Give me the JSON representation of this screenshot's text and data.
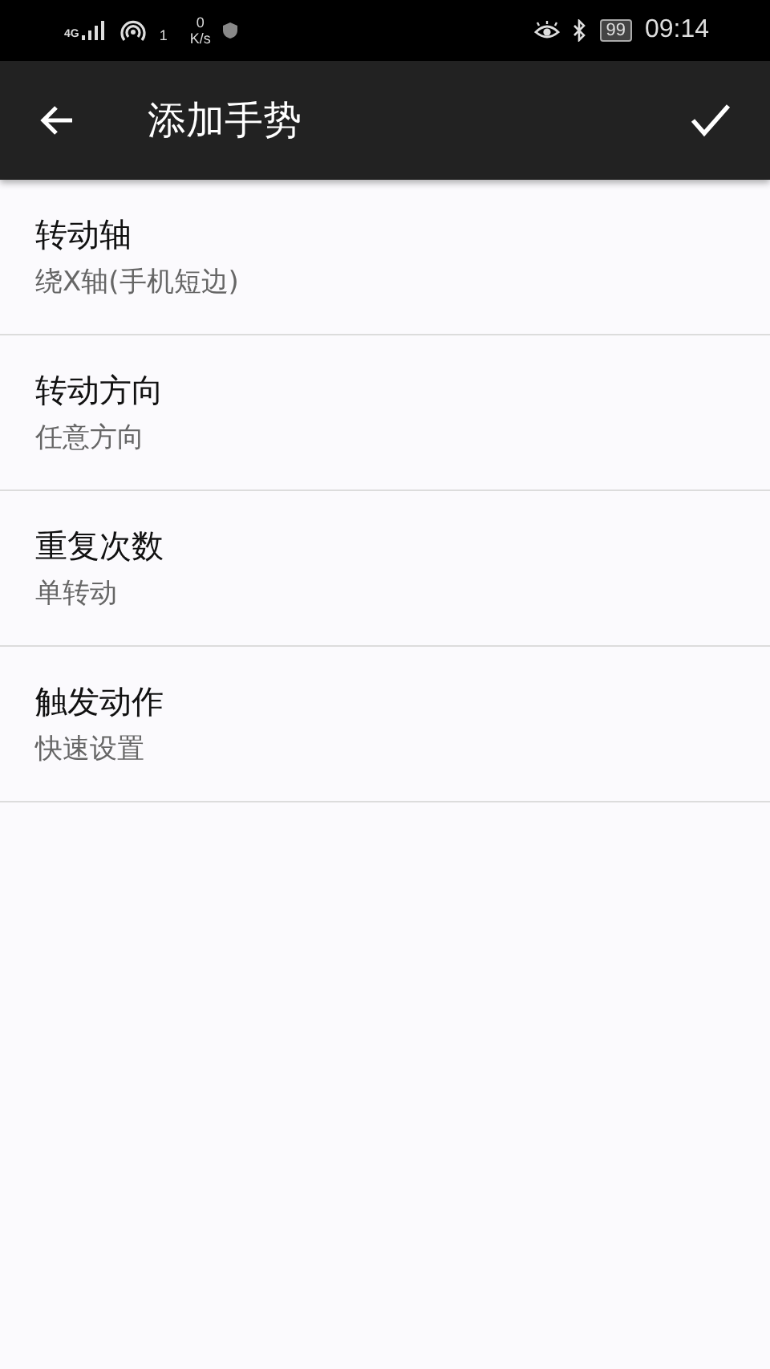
{
  "status_bar": {
    "network": "4G",
    "hotspot_count": "1",
    "speed_value": "0",
    "speed_unit": "K/s",
    "battery": "99",
    "time": "09:14"
  },
  "app_bar": {
    "title": "添加手势"
  },
  "settings": [
    {
      "title": "转动轴",
      "value": "绕X轴(手机短边)"
    },
    {
      "title": "转动方向",
      "value": "任意方向"
    },
    {
      "title": "重复次数",
      "value": "单转动"
    },
    {
      "title": "触发动作",
      "value": "快速设置"
    }
  ]
}
